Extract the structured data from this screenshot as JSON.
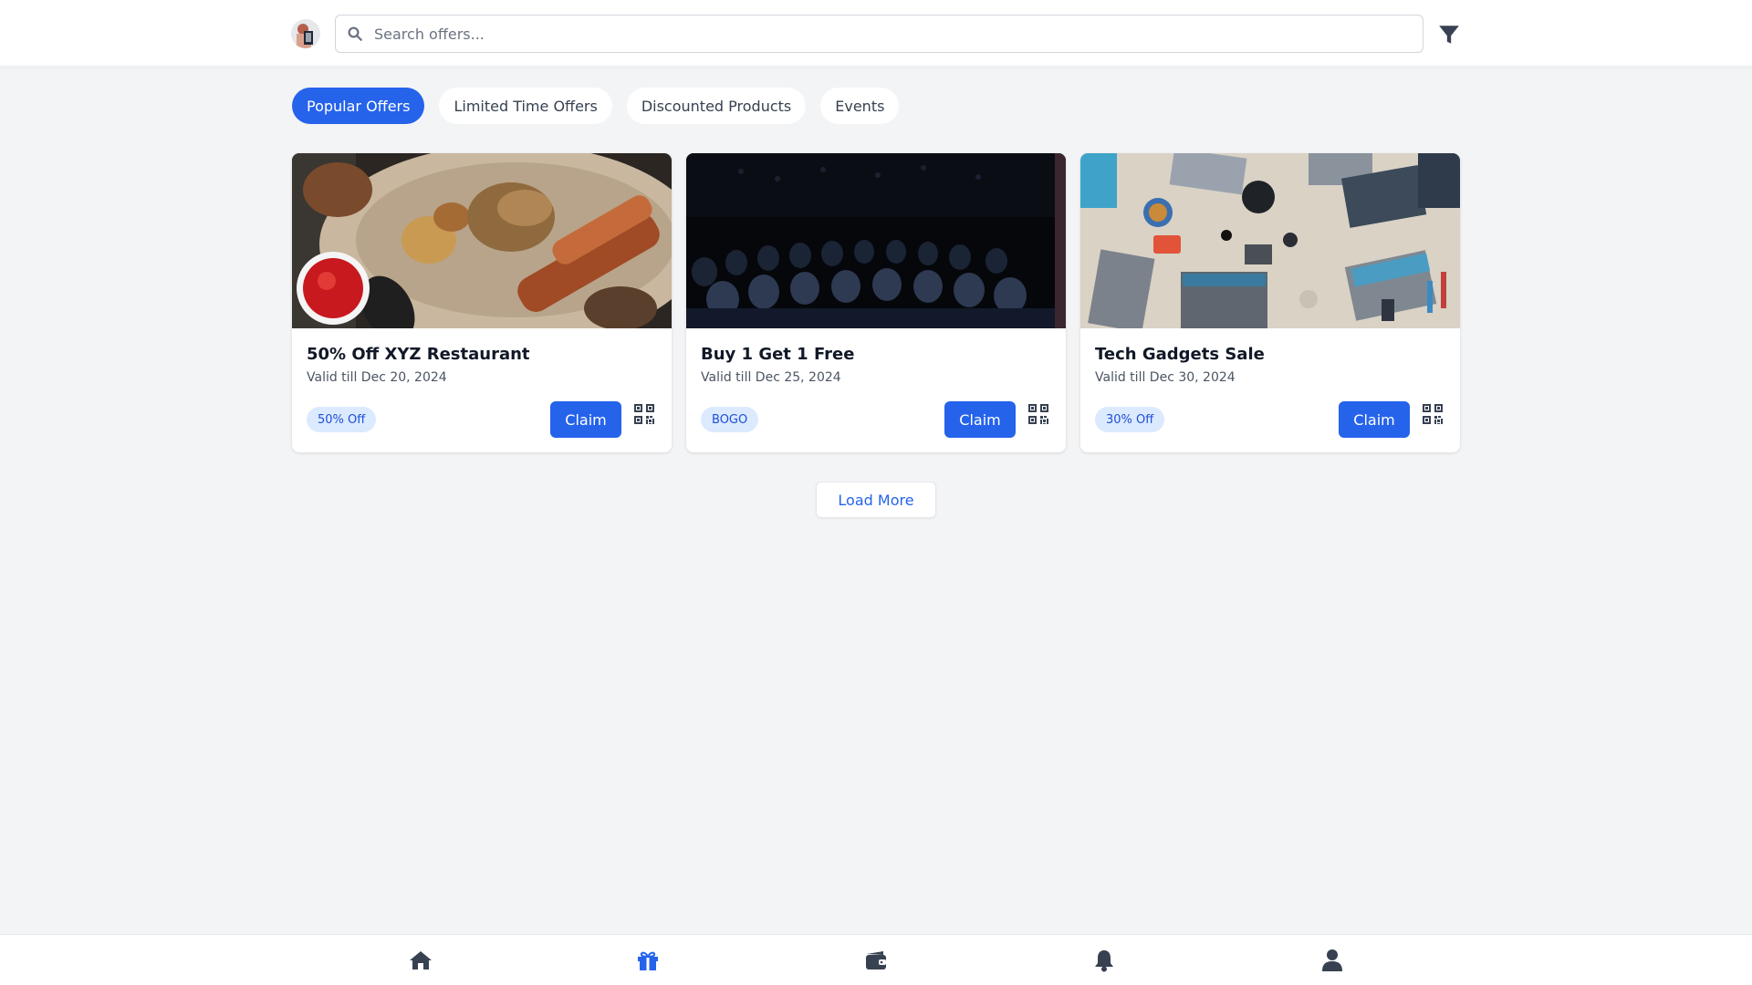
{
  "header": {
    "search_placeholder": "Search offers...",
    "icons": {
      "search": "search-icon",
      "filter": "filter-icon",
      "avatar": "user-avatar"
    }
  },
  "tabs": [
    {
      "label": "Popular Offers",
      "active": true
    },
    {
      "label": "Limited Time Offers",
      "active": false
    },
    {
      "label": "Discounted Products",
      "active": false
    },
    {
      "label": "Events",
      "active": false
    }
  ],
  "offers": [
    {
      "title": "50% Off XYZ Restaurant",
      "valid": "Valid till Dec 20, 2024",
      "badge": "50% Off",
      "claim_label": "Claim",
      "image": "grilled-food-photo"
    },
    {
      "title": "Buy 1 Get 1 Free",
      "valid": "Valid till Dec 25, 2024",
      "badge": "BOGO",
      "claim_label": "Claim",
      "image": "audience-event-photo"
    },
    {
      "title": "Tech Gadgets Sale",
      "valid": "Valid till Dec 30, 2024",
      "badge": "30% Off",
      "claim_label": "Claim",
      "image": "laptops-desk-photo"
    }
  ],
  "load_more_label": "Load More",
  "bottom_nav": [
    {
      "icon": "home-icon",
      "active": false
    },
    {
      "icon": "gift-icon",
      "active": true
    },
    {
      "icon": "wallet-icon",
      "active": false
    },
    {
      "icon": "bell-icon",
      "active": false
    },
    {
      "icon": "user-icon",
      "active": false
    }
  ],
  "colors": {
    "primary": "#2563eb",
    "background": "#f3f4f6",
    "badge_bg": "#dbeafe",
    "badge_text": "#1d4ed8",
    "icon": "#374151"
  }
}
